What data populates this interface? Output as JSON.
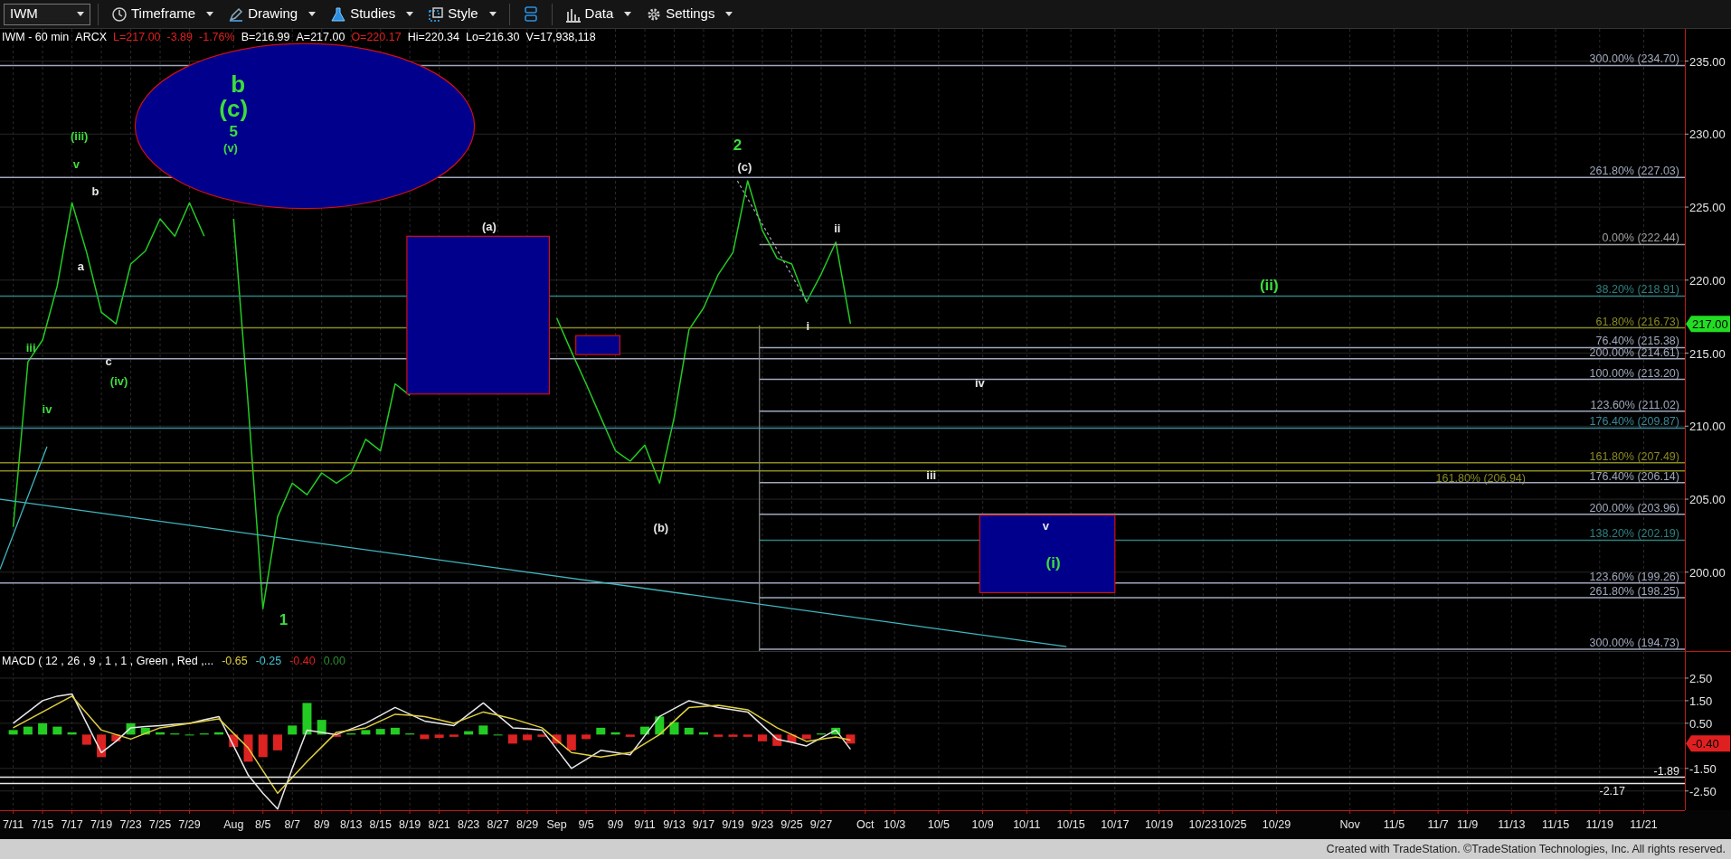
{
  "toolbar": {
    "symbol": "IWM",
    "buttons": [
      {
        "kind": "clock",
        "label": "Timeframe"
      },
      {
        "kind": "pencil",
        "label": "Drawing"
      },
      {
        "kind": "flask",
        "label": "Studies"
      },
      {
        "kind": "frame",
        "label": "Style"
      },
      {
        "kind": "stack"
      },
      {
        "kind": "bars",
        "label": "Data"
      },
      {
        "kind": "gear",
        "label": "Settings"
      }
    ]
  },
  "quote_line": [
    {
      "text": "IWM - 60 min",
      "color": "#ffffff"
    },
    {
      "text": "ARCX",
      "color": "#ffffff"
    },
    {
      "text": "L=217.00",
      "color": "#e02020"
    },
    {
      "text": "-3.89",
      "color": "#e02020"
    },
    {
      "text": "-1.76%",
      "color": "#e02020"
    },
    {
      "text": "B=216.99",
      "color": "#ffffff"
    },
    {
      "text": "A=217.00",
      "color": "#ffffff"
    },
    {
      "text": "O=220.17",
      "color": "#e02020"
    },
    {
      "text": "Hi=220.34",
      "color": "#ffffff"
    },
    {
      "text": "Lo=216.30",
      "color": "#ffffff"
    },
    {
      "text": "V=17,938,118",
      "color": "#ffffff"
    }
  ],
  "price_chart": {
    "chart_data": {
      "type": "line",
      "categories": [
        null,
        null,
        null,
        null,
        null,
        null,
        null,
        null,
        null,
        null,
        null,
        null,
        null,
        null,
        null,
        null,
        null,
        null,
        null,
        null,
        null,
        null,
        null,
        null,
        null,
        null,
        null,
        null,
        null,
        null,
        null,
        null,
        null,
        null,
        null,
        null,
        null,
        null,
        null,
        null,
        null,
        null,
        null,
        null,
        null,
        null,
        null,
        null,
        null,
        null,
        null,
        null,
        null,
        null,
        null,
        null,
        null,
        null,
        null,
        null,
        null,
        null,
        null,
        null,
        null,
        null,
        null,
        null,
        null,
        null,
        null,
        null,
        null,
        null,
        null,
        null,
        null,
        null,
        null,
        null,
        null,
        null,
        null,
        null,
        null,
        null,
        null,
        null,
        null,
        null,
        null,
        null,
        null,
        null,
        null,
        null,
        null,
        null,
        null,
        null,
        null,
        null,
        null,
        null,
        null,
        null,
        null,
        null,
        null,
        null,
        null,
        null,
        null,
        null
      ],
      "series": [
        {
          "color": "#22cc22",
          "values": [
            203.1,
            214.4,
            215.9,
            219.6,
            225.3,
            221.9,
            217.8,
            217.0,
            221.1,
            222.0,
            224.2,
            223.0,
            225.3,
            223.0,
            null,
            224.2,
            211.4,
            197.5,
            203.8,
            206.1,
            205.3,
            206.8,
            206.1,
            206.8,
            209.1,
            208.3,
            212.9,
            212.1,
            null,
            null,
            null,
            null,
            null,
            null,
            null,
            null,
            null,
            217.4,
            215.1,
            212.9,
            210.6,
            208.3,
            207.6,
            208.7,
            206.1,
            210.6,
            216.6,
            218.1,
            220.4,
            221.9,
            226.8,
            223.4,
            221.5,
            221.1,
            218.5,
            220.4,
            222.6,
            217.0,
            null,
            null,
            null,
            null,
            null,
            null,
            null,
            null,
            null,
            null,
            null,
            null,
            null,
            null,
            null,
            null,
            null,
            null,
            null,
            null,
            null,
            null,
            null,
            null,
            null,
            null,
            null,
            null,
            null,
            null,
            null,
            null,
            null,
            null,
            null,
            null,
            null,
            null,
            null,
            null,
            null,
            null,
            null,
            null,
            null,
            null,
            null,
            null,
            null,
            null,
            null,
            null,
            null,
            null,
            null,
            null
          ]
        }
      ],
      "ylim": [
        194.6,
        237.2
      ],
      "yticks": [
        {
          "value": 235,
          "label": "235.00"
        },
        {
          "value": 230,
          "label": "230.00"
        },
        {
          "value": 225,
          "label": "225.00"
        },
        {
          "value": 220,
          "label": "220.00"
        },
        {
          "value": 215,
          "label": "215.00"
        },
        {
          "value": 210,
          "label": "210.00"
        },
        {
          "value": 205,
          "label": "205.00"
        },
        {
          "value": 200,
          "label": "200.00"
        }
      ],
      "grid": true,
      "ref_lines": [
        {
          "axis": "y",
          "value": 234.7,
          "label": "300.00% (234.70)",
          "color": "#a0a8bc"
        },
        {
          "axis": "y",
          "value": 227.03,
          "label": "261.80% (227.03)",
          "color": "#a0a8bc"
        },
        {
          "axis": "y",
          "value": 222.44,
          "label": "0.00% (222.44)",
          "color": "#a0a0a0"
        },
        {
          "axis": "y",
          "value": 218.91,
          "label": "38.20% (218.91)",
          "color": "#2f8080"
        },
        {
          "axis": "y",
          "value": 216.73,
          "label": "61.80% (216.73)",
          "color": "#8a8a22"
        },
        {
          "axis": "y",
          "value": 215.38,
          "label": "76.40% (215.38)",
          "color": "#a0a8bc"
        },
        {
          "axis": "y",
          "value": 214.61,
          "label": "200.00% (214.61)",
          "color": "#a0a8bc"
        },
        {
          "axis": "y",
          "value": 213.2,
          "label": "100.00% (213.20)",
          "color": "#a0a8bc"
        },
        {
          "axis": "y",
          "value": 211.02,
          "label": "123.60% (211.02)",
          "color": "#a0a8bc"
        },
        {
          "axis": "y",
          "value": 209.87,
          "label": "176.40% (209.87)",
          "color": "#3a8a9a"
        },
        {
          "axis": "y",
          "value": 207.49,
          "label": "161.80% (207.49)",
          "color": "#8a8a22"
        },
        {
          "axis": "y",
          "value": 206.94,
          "label": "161.80% (206.94)",
          "color": "#8a8a22"
        },
        {
          "axis": "y",
          "value": 206.14,
          "label": "176.40% (206.14)",
          "color": "#a0a8bc"
        },
        {
          "axis": "y",
          "value": 203.96,
          "label": "200.00% (203.96)",
          "color": "#a0a8bc"
        },
        {
          "axis": "y",
          "value": 202.19,
          "label": "138.20% (202.19)",
          "color": "#2f8080"
        },
        {
          "axis": "y",
          "value": 199.26,
          "label": "123.60% (199.26)",
          "color": "#a0a8bc"
        },
        {
          "axis": "y",
          "value": 198.25,
          "label": "261.80% (198.25)",
          "color": "#a0a8bc"
        },
        {
          "axis": "y",
          "value": 194.73,
          "label": "300.00% (194.73)",
          "color": "#a0a8bc"
        }
      ]
    },
    "wave_labels": [
      {
        "text": "b",
        "color": "#3ddc3d"
      },
      {
        "text": "(c)",
        "color": "#3ddc3d"
      },
      {
        "text": "5",
        "color": "#3ddc3d"
      },
      {
        "text": "(v)",
        "color": "#3ddc3d"
      },
      {
        "text": "(iii)",
        "color": "#3ddc3d"
      },
      {
        "text": "v",
        "color": "#3ddc3d"
      },
      {
        "text": "b",
        "color": "#e6e6e6"
      },
      {
        "text": "a",
        "color": "#e6e6e6"
      },
      {
        "text": "c",
        "color": "#e6e6e6"
      },
      {
        "text": "(iv)",
        "color": "#3ddc3d"
      },
      {
        "text": "iii",
        "color": "#3ddc3d"
      },
      {
        "text": "iv",
        "color": "#3ddc3d"
      },
      {
        "text": "1",
        "color": "#3ddc3d"
      },
      {
        "text": "(a)",
        "color": "#e6e6e6"
      },
      {
        "text": "(b)",
        "color": "#e6e6e6"
      },
      {
        "text": "2",
        "color": "#3ddc3d"
      },
      {
        "text": "(c)",
        "color": "#e6e6e6"
      },
      {
        "text": "ii",
        "color": "#e6e6e6"
      },
      {
        "text": "i",
        "color": "#e6e6e6"
      },
      {
        "text": "(ii)",
        "color": "#3ddc3d"
      },
      {
        "text": "iv",
        "color": "#e6e6e6"
      },
      {
        "text": "iii",
        "color": "#e6e6e6"
      },
      {
        "text": "v",
        "color": "#e6e6e6"
      },
      {
        "text": "(i)",
        "color": "#3ddc3d"
      }
    ],
    "last_price": "217.00"
  },
  "macd_panel": {
    "legend": [
      {
        "text": "MACD ( 12 , 26 , 9 , 1 , 1 , Green , Red ,...",
        "color": "#ffffff"
      },
      {
        "text": "-0.65",
        "color": "#e0d040"
      },
      {
        "text": "-0.25",
        "color": "#40c8d8"
      },
      {
        "text": "-0.40",
        "color": "#e02020"
      },
      {
        "text": "0.00",
        "color": "#2e8b2e"
      }
    ],
    "chart_data": {
      "type": "line",
      "categories": [
        "7/11",
        null,
        "7/15",
        null,
        "7/17",
        null,
        "7/19",
        null,
        "7/23",
        null,
        "7/25",
        null,
        "7/29",
        null,
        null,
        "Aug",
        null,
        "8/5",
        null,
        "8/7",
        null,
        "8/9",
        null,
        "8/13",
        null,
        "8/15",
        null,
        "8/19",
        null,
        "8/21",
        null,
        "8/23",
        null,
        "8/27",
        null,
        "8/29",
        null,
        "Sep",
        null,
        "9/5",
        null,
        "9/9",
        null,
        "9/11",
        null,
        "9/13",
        null,
        "9/17",
        null,
        "9/19",
        null,
        "9/23",
        null,
        "9/25",
        null,
        "9/27",
        null,
        null,
        "Oct",
        null,
        "10/3",
        null,
        null,
        "10/5",
        null,
        null,
        "10/9",
        null,
        null,
        "10/11",
        null,
        null,
        "10/15",
        null,
        null,
        "10/17",
        null,
        null,
        "10/19",
        null,
        null,
        "10/23",
        null,
        "10/25",
        null,
        null,
        "10/29",
        null,
        null,
        null,
        null,
        "Nov",
        null,
        null,
        "11/5",
        null,
        null,
        "11/7",
        null,
        "11/9",
        null,
        null,
        "11/13",
        null,
        null,
        "11/15",
        null,
        null,
        "11/19",
        null,
        null,
        "11/21",
        null,
        null
      ],
      "series": [
        {
          "color": "#e8e8e8",
          "values": [
            0.5,
            1.0,
            1.5,
            1.7,
            1.8,
            0.5,
            -0.8,
            -0.3,
            0.3,
            0.35,
            0.4,
            0.45,
            0.5,
            0.65,
            0.8,
            -0.5,
            -1.8,
            -2.6,
            -3.3,
            -1.5,
            0.2,
            0.1,
            0.0,
            0.25,
            0.5,
            0.85,
            1.2,
            0.9,
            0.6,
            0.5,
            0.4,
            0.9,
            1.4,
            0.85,
            0.3,
            0.25,
            0.2,
            -0.65,
            -1.5,
            -1.1,
            -0.7,
            -0.8,
            -0.9,
            -0.05,
            0.8,
            1.15,
            1.5,
            1.35,
            1.2,
            1.1,
            1.0,
            0.4,
            -0.2,
            -0.35,
            -0.5,
            -0.15,
            0.2,
            -0.65,
            null,
            null,
            null,
            null,
            null,
            null,
            null,
            null,
            null,
            null,
            null,
            null,
            null,
            null,
            null,
            null,
            null,
            null,
            null,
            null,
            null,
            null,
            null,
            null,
            null,
            null,
            null,
            null,
            null,
            null,
            null,
            null,
            null,
            null,
            null,
            null,
            null,
            null,
            null,
            null,
            null,
            null,
            null,
            null,
            null,
            null,
            null,
            null,
            null,
            null,
            null,
            null,
            null,
            null,
            null,
            null
          ]
        },
        {
          "color": "#e0d040",
          "values": [
            0.3,
            0.65,
            1.0,
            1.35,
            1.7,
            0.95,
            0.2,
            0.0,
            -0.2,
            0.05,
            0.3,
            0.4,
            0.5,
            0.6,
            0.7,
            0.05,
            -0.6,
            -1.6,
            -2.6,
            -1.9,
            -1.2,
            -0.55,
            0.1,
            0.2,
            0.3,
            0.6,
            0.9,
            0.85,
            0.8,
            0.65,
            0.5,
            0.75,
            1.0,
            0.85,
            0.7,
            0.5,
            0.3,
            -0.25,
            -0.8,
            -0.9,
            -1.0,
            -0.9,
            -0.8,
            -0.4,
            0.0,
            0.6,
            1.2,
            1.25,
            1.3,
            1.2,
            1.1,
            0.7,
            0.3,
            0.0,
            -0.3,
            -0.2,
            -0.1,
            -0.25,
            null,
            null,
            null,
            null,
            null,
            null,
            null,
            null,
            null,
            null,
            null,
            null,
            null,
            null,
            null,
            null,
            null,
            null,
            null,
            null,
            null,
            null,
            null,
            null,
            null,
            null,
            null,
            null,
            null,
            null,
            null,
            null,
            null,
            null,
            null,
            null,
            null,
            null,
            null,
            null,
            null,
            null,
            null,
            null,
            null,
            null,
            null,
            null,
            null,
            null,
            null,
            null,
            null,
            null,
            null,
            null
          ]
        },
        {
          "type": "bar",
          "color": "#22cc22",
          "values": [
            0.2,
            0.35,
            0.5,
            0.35,
            0.1,
            null,
            null,
            null,
            0.5,
            0.3,
            0.1,
            0.05,
            0.0,
            0.05,
            0.1,
            null,
            null,
            null,
            null,
            0.4,
            1.4,
            0.65,
            null,
            0.05,
            0.2,
            0.25,
            0.3,
            0.05,
            null,
            null,
            null,
            0.15,
            0.4,
            0.0,
            null,
            null,
            null,
            null,
            null,
            null,
            0.3,
            0.1,
            null,
            0.35,
            0.8,
            0.55,
            0.3,
            0.1,
            null,
            null,
            null,
            null,
            null,
            null,
            null,
            0.05,
            0.3,
            null,
            null,
            null,
            null,
            null,
            null,
            null,
            null,
            null,
            null,
            null,
            null,
            null,
            null,
            null,
            null,
            null,
            null,
            null,
            null,
            null,
            null,
            null,
            null,
            null,
            null,
            null,
            null,
            null,
            null,
            null,
            null,
            null,
            null,
            null,
            null,
            null,
            null,
            null,
            null,
            null,
            null,
            null,
            null,
            null,
            null,
            null,
            null,
            null,
            null,
            null,
            null,
            null,
            null,
            null,
            null,
            null
          ]
        },
        {
          "type": "bar",
          "color": "#dd2222",
          "values": [
            null,
            null,
            null,
            null,
            null,
            -0.45,
            -1.0,
            -0.3,
            null,
            null,
            null,
            null,
            null,
            null,
            null,
            -0.55,
            -1.2,
            -1.0,
            -0.7,
            null,
            null,
            null,
            -0.1,
            null,
            null,
            null,
            null,
            null,
            -0.2,
            -0.15,
            -0.1,
            null,
            null,
            null,
            -0.4,
            -0.25,
            -0.1,
            -0.4,
            -0.7,
            -0.2,
            null,
            null,
            -0.1,
            null,
            null,
            null,
            null,
            null,
            -0.1,
            -0.1,
            -0.1,
            -0.3,
            -0.5,
            -0.35,
            -0.2,
            null,
            null,
            -0.4,
            null,
            null,
            null,
            null,
            null,
            null,
            null,
            null,
            null,
            null,
            null,
            null,
            null,
            null,
            null,
            null,
            null,
            null,
            null,
            null,
            null,
            null,
            null,
            null,
            null,
            null,
            null,
            null,
            null,
            null,
            null,
            null,
            null,
            null,
            null,
            null,
            null,
            null,
            null,
            null,
            null,
            null,
            null,
            null,
            null,
            null,
            null,
            null,
            null,
            null,
            null,
            null,
            null,
            null,
            null,
            null
          ]
        }
      ],
      "ylim": [
        -3.35,
        3.7
      ],
      "yticks": [
        {
          "value": 2.5,
          "label": "2.50"
        },
        {
          "value": 1.5,
          "label": "1.50"
        },
        {
          "value": 0.5,
          "label": "0.50"
        },
        {
          "value": -1.5,
          "label": "-1.50"
        },
        {
          "value": -2.5,
          "label": "-2.50"
        }
      ],
      "grid": true,
      "ref_lines": [
        {
          "axis": "y",
          "value": -1.89,
          "label": "-1.89",
          "color": "#e8e8e8"
        },
        {
          "axis": "y",
          "value": -2.17,
          "label": "-2.17",
          "color": "#e8e8e8"
        }
      ]
    },
    "last_value": "-0.40"
  },
  "footer": "Created with TradeStation. ©TradeStation Technologies, Inc. All rights reserved."
}
